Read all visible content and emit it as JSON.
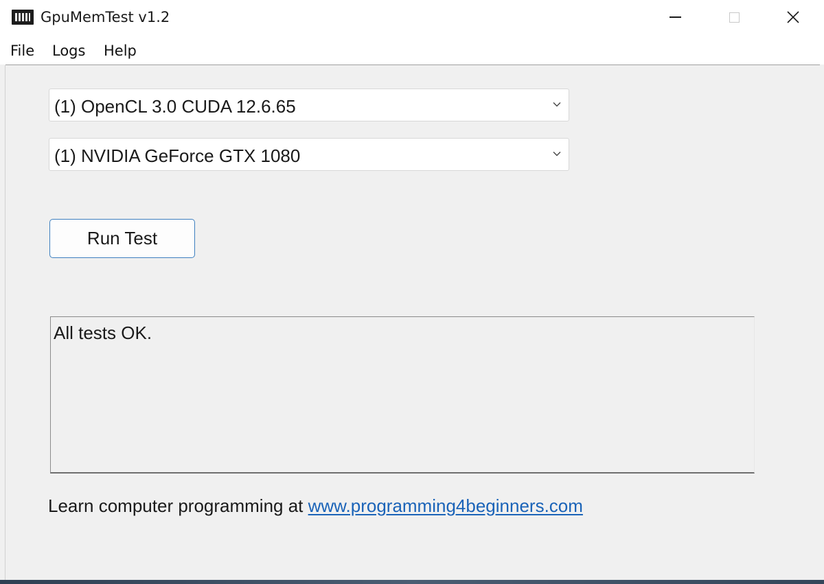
{
  "window": {
    "title": "GpuMemTest v1.2"
  },
  "menu": {
    "file": "File",
    "logs": "Logs",
    "help": "Help"
  },
  "platform_select": {
    "value": "(1) OpenCL 3.0 CUDA 12.6.65"
  },
  "device_select": {
    "value": "(1) NVIDIA GeForce GTX 1080"
  },
  "run_button": {
    "label": "Run Test"
  },
  "results": {
    "text": "All tests OK."
  },
  "footer": {
    "prefix": "Learn computer programming at ",
    "link": "www.programming4beginners.com",
    "link_color": "#1a63b8"
  },
  "colors": {
    "accent_border": "#3d7fbf",
    "window_bg": "#f0f0f0"
  }
}
